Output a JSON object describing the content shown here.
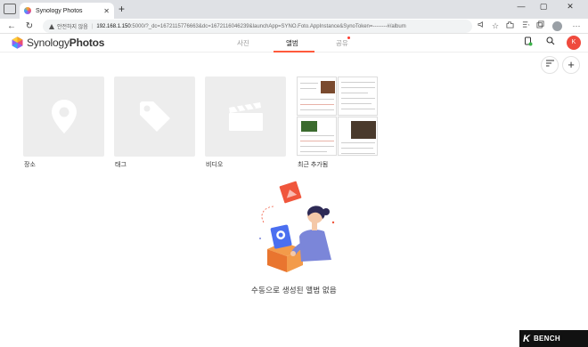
{
  "browser": {
    "tab_title": "Synology Photos",
    "tab_close": "✕",
    "new_tab": "+",
    "win_minimize": "—",
    "win_maximize": "▢",
    "win_close": "✕",
    "back": "←",
    "reload": "↻",
    "url_warning": "안전하지 않음",
    "url_sep": "|",
    "url_host": "192.168.1.150",
    "url_path": ":5000/?_dc=1672115776663&dc=1672116046239&launchApp=SYNO.Foto.AppInstance&SynoToken=--------#/album"
  },
  "app": {
    "logo_prefix": "Synology",
    "logo_bold": "Photos",
    "nav": [
      "사진",
      "앨범",
      "공유"
    ],
    "active_nav": "앨범",
    "avatar_letter": "K"
  },
  "toolbar": {
    "sort_icon": "≡",
    "add_icon": "+"
  },
  "albums": [
    {
      "label": "장소",
      "icon": "location-pin-icon"
    },
    {
      "label": "태그",
      "icon": "tag-icon"
    },
    {
      "label": "비디오",
      "icon": "clapperboard-icon"
    },
    {
      "label": "최근 추가됨",
      "icon": "thumbnail-collage"
    }
  ],
  "empty_state": {
    "message": "수동으로 생성된 앨범 없음"
  },
  "watermark": {
    "mark": "K",
    "text": "BENCH"
  },
  "colors": {
    "accent": "#ff5a3c",
    "card_bg": "#ededed",
    "card_icon": "#ffffff",
    "avatar_bg": "#ef4a3d"
  }
}
